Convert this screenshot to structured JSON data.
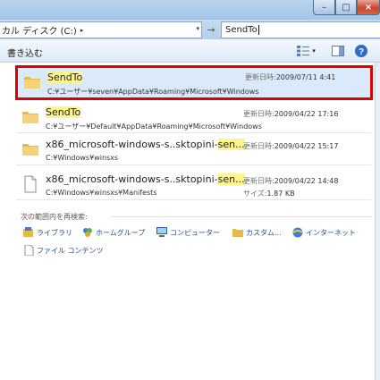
{
  "window": {
    "min_glyph": "–",
    "max_glyph": "□",
    "close_glyph": "×"
  },
  "address": {
    "crumb": "カル ディスク (C:)",
    "sep": "▸",
    "dropdown": "▾"
  },
  "nav": {
    "refresh_glyph": "→"
  },
  "search": {
    "value": "SendTo"
  },
  "toolbar": {
    "burn_label": "書き込む",
    "views_arrow": "▾",
    "help_glyph": "?"
  },
  "results": [
    {
      "name_hl": "SendTo",
      "name_rest": "",
      "path": "C:¥ユーザー¥seven¥AppData¥Roaming¥Microsoft¥Windows",
      "meta_label": "更新日時:",
      "meta_value": "2009/07/11 4:41",
      "icon": "folder-icon",
      "selected": true
    },
    {
      "name_hl": "SendTo",
      "name_rest": "",
      "path": "C:¥ユーザー¥Default¥AppData¥Roaming¥Microsoft¥Windows",
      "meta_label": "更新日時:",
      "meta_value": "2009/04/22 17:16",
      "icon": "folder-icon",
      "selected": false
    },
    {
      "name_pre": "x86_microsoft-windows-s..sktopini-",
      "name_hl": "sen...",
      "path": "C:¥Windows¥winsxs",
      "meta_label": "更新日時:",
      "meta_value": "2009/04/22 15:17",
      "icon": "folder-icon",
      "selected": false
    },
    {
      "name_pre": "x86_microsoft-windows-s..sktopini-",
      "name_hl": "sen...",
      "path": "C:¥Windows¥winsxs¥Manifests",
      "meta_label": "更新日時:",
      "meta_value": "2009/04/22 14:48",
      "size_label": "サイズ:",
      "size_value": "1.87 KB",
      "icon": "file-icon",
      "selected": false
    }
  ],
  "rescope": {
    "label": "次の範囲内を再検索:",
    "links": [
      {
        "label": "ライブラリ",
        "icon": "library-icon"
      },
      {
        "label": "ホームグループ",
        "icon": "homegroup-icon"
      },
      {
        "label": "コンピューター",
        "icon": "computer-icon"
      },
      {
        "label": "カスタム...",
        "icon": "custom-folder-icon"
      },
      {
        "label": "インターネット",
        "icon": "internet-icon"
      },
      {
        "label": "ファイル コンテンツ",
        "icon": "file-contents-icon"
      }
    ]
  },
  "colors": {
    "selection_border": "#e00000",
    "highlight": "#fef58c",
    "link": "#1f4d8f"
  }
}
